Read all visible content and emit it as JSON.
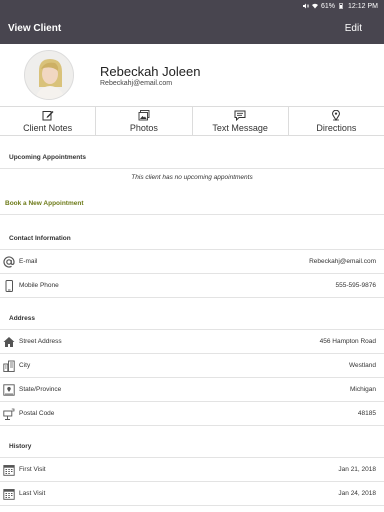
{
  "status": {
    "battery": "61%",
    "time": "12:12 PM"
  },
  "app_bar": {
    "title": "View Client",
    "edit_label": "Edit"
  },
  "client": {
    "name": "Rebeckah Joleen",
    "email": "Rebeckahj@email.com"
  },
  "actions": [
    {
      "label": "Client Notes",
      "icon": "notes-icon"
    },
    {
      "label": "Photos",
      "icon": "photos-icon"
    },
    {
      "label": "Text Message",
      "icon": "message-icon"
    },
    {
      "label": "Directions",
      "icon": "location-pin-icon"
    }
  ],
  "appointments": {
    "heading": "Upcoming Appointments",
    "empty_text": "This client has no upcoming appointments",
    "book_label": "Book a New Appointment"
  },
  "contact": {
    "heading": "Contact Information",
    "rows": [
      {
        "label": "E-mail",
        "value": "Rebeckahj@email.com",
        "icon": "at-sign-icon"
      },
      {
        "label": "Mobile Phone",
        "value": "555-595-9876",
        "icon": "phone-icon"
      }
    ]
  },
  "address": {
    "heading": "Address",
    "rows": [
      {
        "label": "Street Address",
        "value": "456 Hampton Road",
        "icon": "home-icon"
      },
      {
        "label": "City",
        "value": "Westland",
        "icon": "city-icon"
      },
      {
        "label": "State/Province",
        "value": "Michigan",
        "icon": "map-icon"
      },
      {
        "label": "Postal Code",
        "value": "48185",
        "icon": "mailbox-icon"
      }
    ]
  },
  "history": {
    "heading": "History",
    "rows": [
      {
        "label": "First Visit",
        "value": "Jan 21, 2018",
        "icon": "calendar-icon"
      },
      {
        "label": "Last Visit",
        "value": "Jan 24, 2018",
        "icon": "calendar-icon"
      }
    ]
  },
  "colors": {
    "header_bg": "#48454f",
    "link_green": "#6d7a18"
  }
}
